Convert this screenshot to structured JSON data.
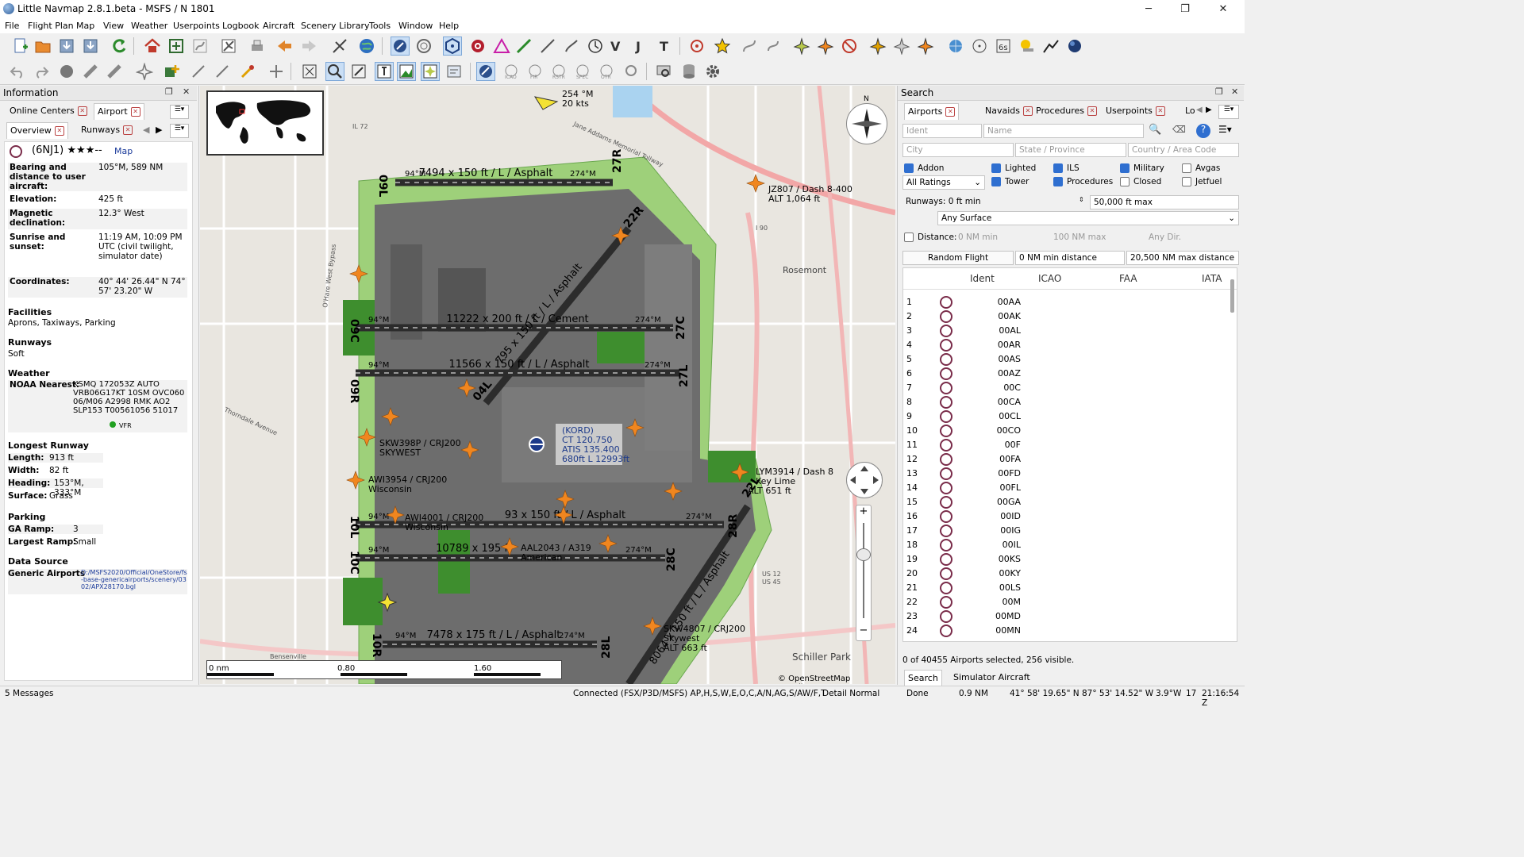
{
  "window": {
    "title": "Little Navmap 2.8.1.beta - MSFS / N 1801",
    "minimize": "─",
    "maximize": "❐",
    "close": "✕"
  },
  "menu": [
    "File",
    "Flight Plan",
    "Map",
    "View",
    "Weather",
    "Userpoints",
    "Logbook",
    "Aircraft",
    "Scenery Library",
    "Tools",
    "Window",
    "Help"
  ],
  "info_panel": {
    "title": "Information",
    "tabs": [
      "Online Centers",
      "Airport"
    ],
    "subtabs": [
      "Overview",
      "Runways"
    ],
    "airport": {
      "ident": "(6NJ1)",
      "rating": "★★★--",
      "map_link": "Map"
    },
    "fields": [
      {
        "label": "Bearing and distance to user aircraft:",
        "value": "105°M, 589 NM"
      },
      {
        "label": "Elevation:",
        "value": "425 ft"
      },
      {
        "label": "Magnetic declination:",
        "value": "12.3° West"
      },
      {
        "label": "Sunrise and sunset:",
        "value": "11:19 AM, 10:09 PM UTC (civil twilight, simulator date)"
      },
      {
        "label": "Coordinates:",
        "value": "40° 44' 26.44\" N 74° 57' 23.20\" W"
      }
    ],
    "facilities_head": "Facilities",
    "facilities": "Aprons, Taxiways, Parking",
    "runways_head": "Runways",
    "runways": "Soft",
    "weather_head": "Weather",
    "noaa_label": "NOAA Nearest:",
    "noaa_value": "KSMQ 172053Z AUTO VRB06G17KT 10SM OVC060 06/M06 A2998 RMK AO2 SLP153 T00561056 51017",
    "vfr": "VFR",
    "longest_head": "Longest Runway",
    "longest": [
      {
        "label": "Length:",
        "value": "913 ft"
      },
      {
        "label": "Width:",
        "value": "82 ft"
      },
      {
        "label": "Heading:",
        "value": "153°M, 333°M"
      },
      {
        "label": "Surface:",
        "value": "Grass"
      }
    ],
    "parking_head": "Parking",
    "parking": [
      {
        "label": "GA Ramp:",
        "value": "3"
      },
      {
        "label": "Largest Ramp:",
        "value": "Small"
      }
    ],
    "source_head": "Data Source",
    "source_label": "Generic Airports",
    "source_path": "D:/MSFS2020/Official/OneStore/fs-base-genericairports/scenery/0302/APX28170.bgl"
  },
  "map": {
    "wind": "254 °M\n20 kts",
    "runway_labels": [
      "7494 x 150 ft / L / Asphalt",
      "11222 x 200 ft / L / Cement",
      "11566 x 150 ft / L / Asphalt",
      "10789 x 195 ft",
      "7478 x 175 ft / L / Asphalt",
      "795 x 150 ft / L / Asphalt",
      "8064 x 150 ft / L / Asphalt",
      "93 x 150 ft / L / Asphalt"
    ],
    "runway_ends": [
      "09R",
      "27L",
      "09C",
      "27C",
      "10L",
      "28R",
      "10C",
      "28C",
      "10R",
      "28L",
      "22L",
      "04L",
      "27R",
      "09L",
      "22R"
    ],
    "heading_marks": [
      "94°M",
      "274°M",
      "223°M",
      "43°M",
      "45°M"
    ],
    "aircraft_labels": [
      {
        "text": "JZ807 / Dash 8-400",
        "sub": "ALT 1,064 ft"
      },
      {
        "text": "SKW398P / CRJ200",
        "sub": "SKYWEST"
      },
      {
        "text": "AWI3954 / CRJ200",
        "sub": "Wisconsin"
      },
      {
        "text": "AWI4001 / CRJ200",
        "sub": "Wisconsin"
      },
      {
        "text": "AAL2043 / A319",
        "sub": "American"
      },
      {
        "text": "SKW4807 / CRJ200",
        "sub": "Skywest"
      },
      {
        "text": "ALT 663 ft",
        "sub": ""
      },
      {
        "text": "LYM3914 / Dash 8",
        "sub": "Key Lime"
      },
      {
        "text": "ALT 651 ft",
        "sub": ""
      }
    ],
    "airport_label": {
      "line1": "(KORD)",
      "line2": "CT 120.750",
      "line3": "ATIS 135.400",
      "line4": "680ft L 12993ft"
    },
    "scale": {
      "zero": "0 nm",
      "mid": "0.80",
      "end": "1.60"
    },
    "attribution": "© OpenStreetMap contributors",
    "streets": [
      "Jane Addams Memorial Tollway",
      "IL 72",
      "I 90",
      "US 12",
      "US 45",
      "Schiller Park",
      "Rosemont",
      "Bensenville",
      "Thorndale Avenue",
      "O'Hare West Bypass",
      "Elmhurst Road"
    ]
  },
  "search_panel": {
    "title": "Search",
    "tabs": [
      "Airports",
      "Navaids",
      "Procedures",
      "Userpoints",
      "Lo"
    ],
    "ident_ph": "Ident",
    "name_ph": "Name",
    "city_ph": "City",
    "state_ph": "State / Province",
    "country_ph": "Country / Area Code",
    "checks": [
      {
        "label": "Addon",
        "on": true
      },
      {
        "label": "Lighted",
        "on": true
      },
      {
        "label": "ILS",
        "on": true
      },
      {
        "label": "Military",
        "on": true
      },
      {
        "label": "Avgas",
        "on": false
      },
      {
        "label": "Tower",
        "on": true
      },
      {
        "label": "Procedures",
        "on": true
      },
      {
        "label": "Closed",
        "on": false
      },
      {
        "label": "Jetfuel",
        "on": false
      }
    ],
    "ratings": "All Ratings",
    "runways_label": "Runways: 0 ft min",
    "runways_max": "50,000 ft max",
    "surface": "Any Surface",
    "distance_label": "Distance:",
    "dist_min": "0 NM min",
    "dist_max": "100 NM max",
    "dist_dir": "Any Dir.",
    "random_flight": "Random Flight",
    "rand_min": "0 NM min distance",
    "rand_max": "20,500 NM max distance",
    "columns": [
      "Ident",
      "ICAO",
      "FAA",
      "IATA"
    ],
    "rows": [
      [
        "1",
        "00AA"
      ],
      [
        "2",
        "00AK"
      ],
      [
        "3",
        "00AL"
      ],
      [
        "4",
        "00AR"
      ],
      [
        "5",
        "00AS"
      ],
      [
        "6",
        "00AZ"
      ],
      [
        "7",
        "00C"
      ],
      [
        "8",
        "00CA"
      ],
      [
        "9",
        "00CL"
      ],
      [
        "10",
        "00CO"
      ],
      [
        "11",
        "00F"
      ],
      [
        "12",
        "00FA"
      ],
      [
        "13",
        "00FD"
      ],
      [
        "14",
        "00FL"
      ],
      [
        "15",
        "00GA"
      ],
      [
        "16",
        "00ID"
      ],
      [
        "17",
        "00IG"
      ],
      [
        "18",
        "00IL"
      ],
      [
        "19",
        "00KS"
      ],
      [
        "20",
        "00KY"
      ],
      [
        "21",
        "00LS"
      ],
      [
        "22",
        "00M"
      ],
      [
        "23",
        "00MD"
      ],
      [
        "24",
        "00MN"
      ]
    ],
    "summary": "0 of 40455 Airports selected, 256 visible.",
    "bottom_tabs": [
      "Search",
      "Simulator Aircraft"
    ]
  },
  "status": {
    "messages": "5 Messages",
    "connected": "Connected (FSX/P3D/MSFS) AP,H,S,W,E,O,C,A/N,AG,S/AW/F,T",
    "detail": "Detail Normal",
    "done": "Done",
    "dist": "0.9 NM",
    "coords": "41° 58' 19.65\" N 87° 53' 14.52\" W",
    "magvar": "3.9°W",
    "zoom": "17",
    "time": "21:16:54 Z"
  },
  "colors": {
    "map_bg": "#e9e6e0",
    "grass": "#9ed07a",
    "apron": "#6d6d6d",
    "runway": "#3a3a3a",
    "aircraft": "#f0861f",
    "road": "#f2b6b6"
  }
}
